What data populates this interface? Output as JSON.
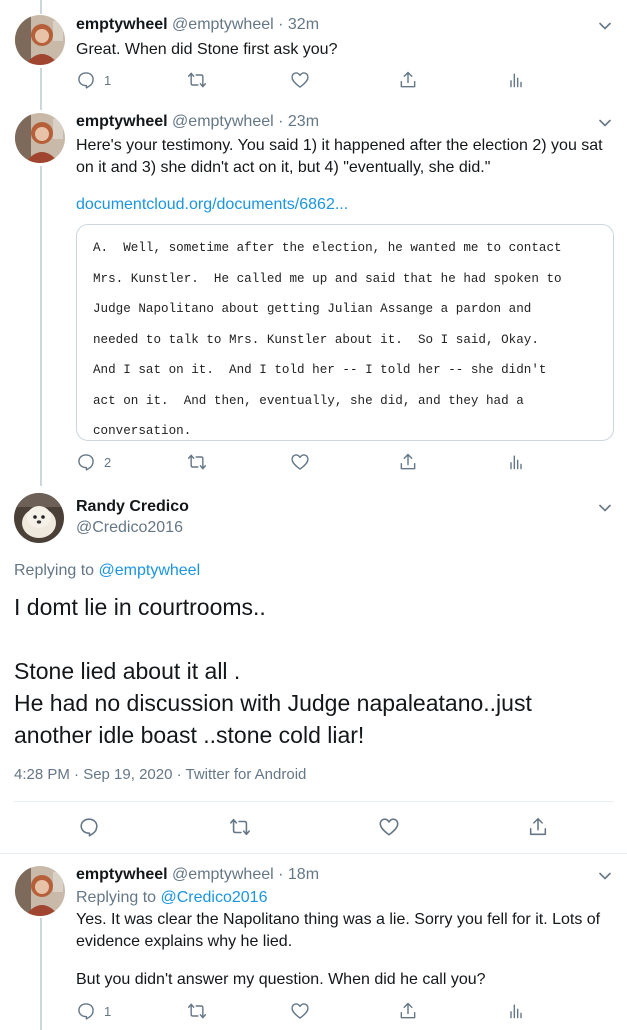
{
  "tweets": [
    {
      "name": "emptywheel",
      "handle": "@emptywheel",
      "time": "· 32m",
      "text": "Great. When did Stone first ask you?",
      "reply_count": "1"
    },
    {
      "name": "emptywheel",
      "handle": "@emptywheel",
      "time": "· 23m",
      "text": "Here's your testimony. You said 1) it happened after the election 2) you sat on it and 3) she didn't act on it, but 4) \"eventually, she did.\"",
      "link": "documentcloud.org/documents/6862...",
      "quote_lines": [
        "A.  Well, sometime after the election, he wanted me to contact",
        "Mrs. Kunstler.  He called me up and said that he had spoken to",
        "Judge Napolitano about getting Julian Assange a pardon and",
        "needed to talk to Mrs. Kunstler about it.  So I said, Okay.",
        "And I sat on it.  And I told her -- I told her -- she didn't",
        "act on it.  And then, eventually, she did, and they had a",
        "conversation."
      ],
      "reply_count": "2"
    }
  ],
  "main_tweet": {
    "name": "Randy Credico",
    "handle": "@Credico2016",
    "replying_prefix": "Replying to ",
    "replying_to": "@emptywheel",
    "lines": [
      "I domt lie in courtrooms..",
      "",
      "Stone lied about it all .",
      "He had no discussion with Judge napaleatano..just",
      "another idle boast ..stone cold liar!"
    ],
    "timestamp": "4:28 PM · Sep 19, 2020 · Twitter for Android"
  },
  "reply_tweet": {
    "name": "emptywheel",
    "handle": "@emptywheel",
    "time": "· 18m",
    "replying_prefix": "Replying to ",
    "replying_to": "@Credico2016",
    "text1": "Yes. It was clear the Napolitano thing was a lie. Sorry you fell for it. Lots of evidence explains why he lied.",
    "text2": "But you didn't answer my question. When did he call you?",
    "reply_count": "1"
  },
  "colors": {
    "link": "#1b95e0",
    "secondary": "#657786",
    "divider": "#e6ecf0"
  }
}
